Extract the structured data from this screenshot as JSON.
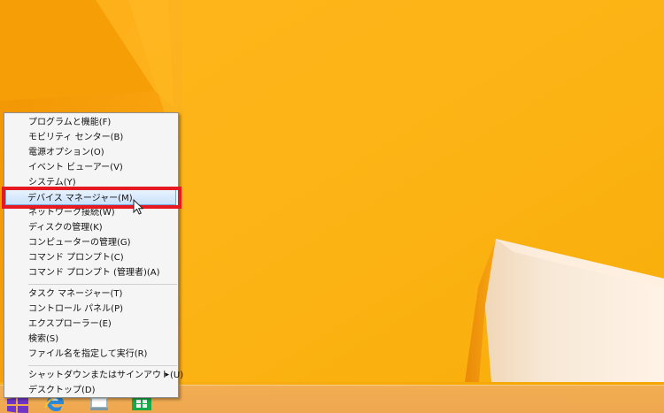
{
  "colors": {
    "desktop_base": "#f7b31b",
    "menu_background": "#f5f5f5",
    "menu_border": "#8f8f8f",
    "selection_border": "#7aa7de",
    "annotation_red": "#e5191f"
  },
  "desktop": {
    "wallpaper": "orange-geometric-wallpaper"
  },
  "taskbar": {
    "start_icon": "windows-start-icon",
    "apps": [
      {
        "name": "internet-explorer-icon"
      },
      {
        "name": "file-explorer-icon"
      },
      {
        "name": "store-icon"
      }
    ]
  },
  "context_menu": {
    "items": [
      {
        "label": "プログラムと機能(F)"
      },
      {
        "label": "モビリティ センター(B)"
      },
      {
        "label": "電源オプション(O)"
      },
      {
        "label": "イベント ビューアー(V)"
      },
      {
        "label": "システム(Y)"
      },
      {
        "label": "デバイス マネージャー(M)",
        "selected": true
      },
      {
        "label": "ネットワーク接続(W)"
      },
      {
        "label": "ディスクの管理(K)"
      },
      {
        "label": "コンピューターの管理(G)"
      },
      {
        "label": "コマンド プロンプト(C)"
      },
      {
        "label": "コマンド プロンプト (管理者)(A)"
      },
      {
        "label": "タスク マネージャー(T)"
      },
      {
        "label": "コントロール パネル(P)"
      },
      {
        "label": "エクスプローラー(E)"
      },
      {
        "label": "検索(S)"
      },
      {
        "label": "ファイル名を指定して実行(R)"
      },
      {
        "label": "シャットダウンまたはサインアウト(U)",
        "has_submenu": true,
        "submenu_symbol": "▸"
      },
      {
        "label": "デスクトップ(D)"
      }
    ]
  }
}
